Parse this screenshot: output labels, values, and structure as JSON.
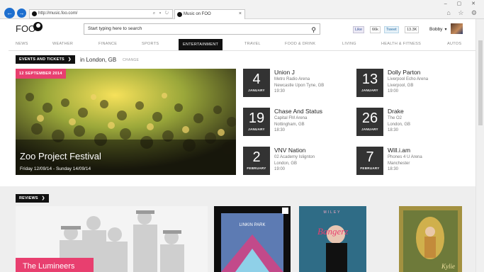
{
  "browser": {
    "url": "http://music.foo.com/",
    "tab_title": "Music on FOO",
    "tab_close": "×",
    "address_tools": "⌕ ▾ ↻",
    "right_icons": "⌂ ☆ ⚙",
    "caption": "– ▢ ✕"
  },
  "site": {
    "logo": "FOO",
    "search_placeholder": "Start typing here to search",
    "fb_like": "Like",
    "fb_count": "66k",
    "tweet": "Tweet",
    "tweet_count": "13.3K",
    "user_name": "Bobby"
  },
  "nav": {
    "items": [
      "NEWS",
      "WEATHER",
      "FINANCE",
      "SPORTS",
      "ENTERTAINMENT",
      "TRAVEL",
      "FOOD & DRINK",
      "LIVING",
      "HEALTH & FITNESS",
      "AUTOS"
    ],
    "active": "ENTERTAINMENT"
  },
  "events": {
    "header": "EVENTS AND TICKETS",
    "location_prefix": "in London, GB",
    "change_label": "CHANGE",
    "featured": {
      "date_badge": "12 SEPTEMBER 2014",
      "title": "Zoo Project Festival",
      "dates": "Friday 12/09/14 - Sunday 14/09/14"
    },
    "list": [
      {
        "day": "4",
        "month": "JANUARY",
        "name": "Union J",
        "venue": "Metro Radio Arena",
        "city": "Newcastle Upon Tyne, GB",
        "time": "19:30"
      },
      {
        "day": "13",
        "month": "JANUARY",
        "name": "Dolly Parton",
        "venue": "Liverpool Echo Arena",
        "city": "Liverpool, GB",
        "time": "19:00"
      },
      {
        "day": "19",
        "month": "JANUARY",
        "name": "Chase And Status",
        "venue": "Capital FM Arena",
        "city": "Nottingham, GB",
        "time": "18:30"
      },
      {
        "day": "26",
        "month": "JANUARY",
        "name": "Drake",
        "venue": "The O2",
        "city": "London, GB",
        "time": "18:30"
      },
      {
        "day": "2",
        "month": "FEBRUARY",
        "name": "VNV Nation",
        "venue": "02 Academy Islignton",
        "city": "London, GB",
        "time": "19:00"
      },
      {
        "day": "7",
        "month": "FEBRUARY",
        "name": "Will.i.am",
        "venue": "Phones 4 U Arena",
        "city": "Manchester",
        "time": "18:30"
      }
    ]
  },
  "reviews": {
    "header": "REVIEWS",
    "featured_title": "The Lumineers",
    "album_text": {
      "linkin_park": "LINKIN PARK",
      "bangerz": "Bangerz",
      "miley_top": "MILEY",
      "kylie": "Kylie"
    }
  },
  "colors": {
    "accent_pink": "#e83f6f",
    "dark": "#111111",
    "date_box": "#333333"
  }
}
